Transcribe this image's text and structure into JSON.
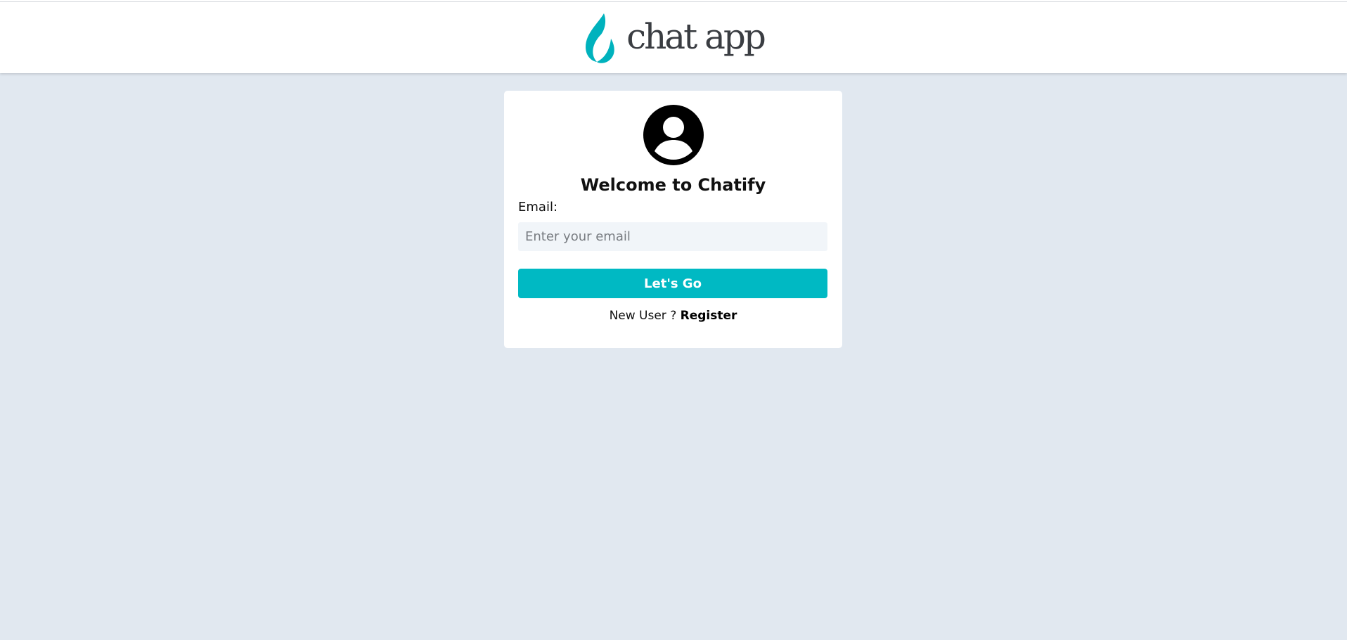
{
  "header": {
    "logo_text": "chat app",
    "logo_color": "#00b2bd",
    "logo_text_color": "#3a3d42"
  },
  "login": {
    "avatar_icon": "user-circle-icon",
    "welcome_title": "Welcome to Chatify",
    "email_label": "Email:",
    "email_value": "",
    "email_placeholder": "Enter your email",
    "submit_label": "Let's Go",
    "new_user_prompt": "New User ?",
    "register_label": "Register"
  },
  "colors": {
    "background": "#e1e8f0",
    "card": "#ffffff",
    "accent": "#00b9c3",
    "input_bg": "#f1f5f9"
  }
}
